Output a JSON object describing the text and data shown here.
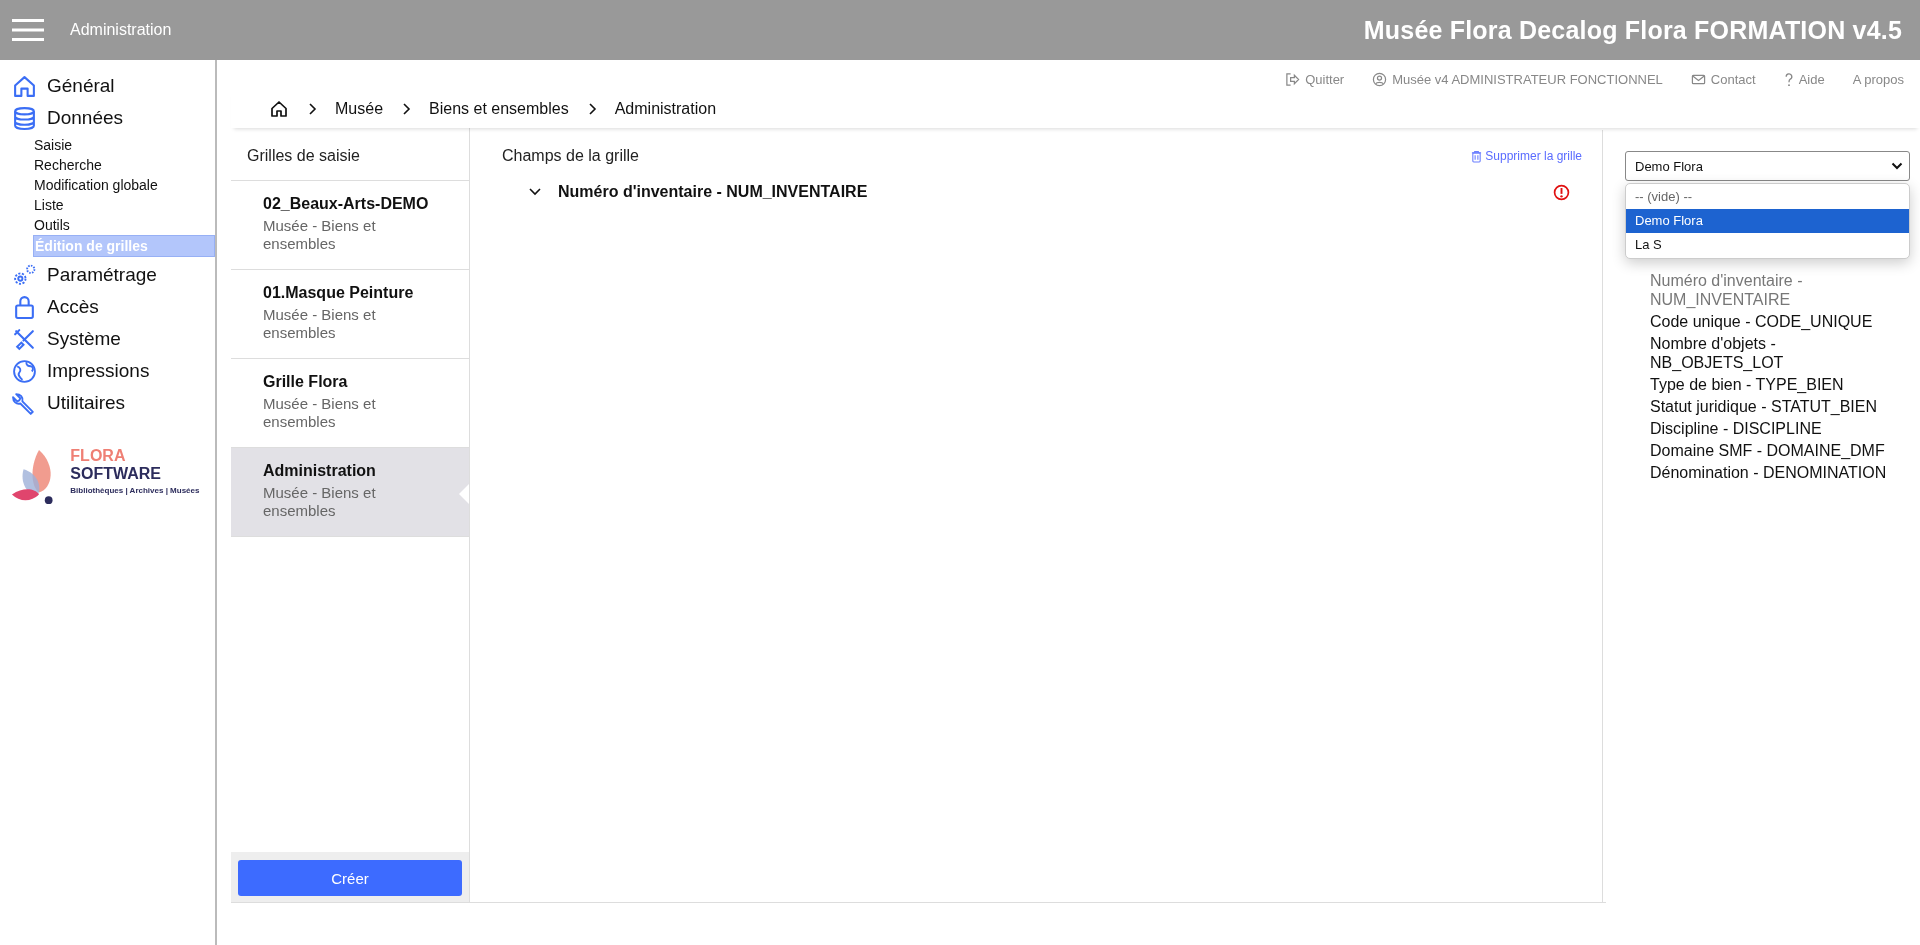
{
  "header": {
    "section": "Administration",
    "app_title": "Musée Flora Decalog Flora FORMATION v4.5"
  },
  "top_links": [
    {
      "kind": "logout",
      "label": "Quitter"
    },
    {
      "kind": "user",
      "label": "Musée v4 ADMINISTRATEUR FONCTIONNEL"
    },
    {
      "kind": "mail",
      "label": "Contact"
    },
    {
      "kind": "help",
      "label": "Aide"
    },
    {
      "kind": "plain",
      "label": "A propos"
    }
  ],
  "breadcrumb": [
    "Musée",
    "Biens et ensembles",
    "Administration"
  ],
  "sidebar": {
    "items": [
      {
        "kind": "home",
        "label": "Général"
      },
      {
        "kind": "database",
        "label": "Données",
        "children": [
          {
            "label": "Saisie",
            "selected": false
          },
          {
            "label": "Recherche",
            "selected": false
          },
          {
            "label": "Modification globale",
            "selected": false
          },
          {
            "label": "Liste",
            "selected": false
          },
          {
            "label": "Outils",
            "selected": false
          },
          {
            "label": "Édition de grilles",
            "selected": true
          }
        ]
      },
      {
        "kind": "gears",
        "label": "Paramétrage"
      },
      {
        "kind": "lock",
        "label": "Accès"
      },
      {
        "kind": "tools",
        "label": "Système"
      },
      {
        "kind": "globe",
        "label": "Impressions"
      },
      {
        "kind": "wrench",
        "label": "Utilitaires"
      }
    ],
    "logo": {
      "brand_1": "FLORA",
      "brand_2": "SOFTWARE",
      "tagline": "Bibliothèques | Archives | Musées"
    }
  },
  "grids": {
    "title": "Grilles de saisie",
    "items": [
      {
        "name": "02_Beaux-Arts-DEMO",
        "subtitle": "Musée - Biens et ensembles",
        "selected": false
      },
      {
        "name": "01.Masque Peinture",
        "subtitle": "Musée - Biens et ensembles",
        "selected": false
      },
      {
        "name": "Grille Flora",
        "subtitle": "Musée - Biens et ensembles",
        "selected": false
      },
      {
        "name": "Administration",
        "subtitle": "Musée - Biens et ensembles",
        "selected": true
      }
    ],
    "create_button": "Créer"
  },
  "fields_panel": {
    "title": "Champs de la grille",
    "delete_link": "Supprimer la grille",
    "fields": [
      {
        "label": "Numéro d'inventaire - NUM_INVENTAIRE",
        "expanded": true,
        "error": true
      }
    ]
  },
  "right_panel": {
    "select": {
      "value": "Demo Flora",
      "options": [
        {
          "label": "-- (vide) --",
          "selected": false
        },
        {
          "label": "Demo Flora",
          "selected": true
        },
        {
          "label": "La S",
          "selected": false
        }
      ]
    },
    "fields": [
      {
        "label": "Numéro d'inventaire - NUM_INVENTAIRE",
        "disabled": true
      },
      {
        "label": "Code unique - CODE_UNIQUE",
        "disabled": false
      },
      {
        "label": "Nombre d'objets - NB_OBJETS_LOT",
        "disabled": false
      },
      {
        "label": "Type de bien - TYPE_BIEN",
        "disabled": false
      },
      {
        "label": "Statut juridique - STATUT_BIEN",
        "disabled": false
      },
      {
        "label": "Discipline - DISCIPLINE",
        "disabled": false
      },
      {
        "label": "Domaine SMF - DOMAINE_DMF",
        "disabled": false
      },
      {
        "label": "Dénomination - DENOMINATION",
        "disabled": false
      }
    ]
  }
}
